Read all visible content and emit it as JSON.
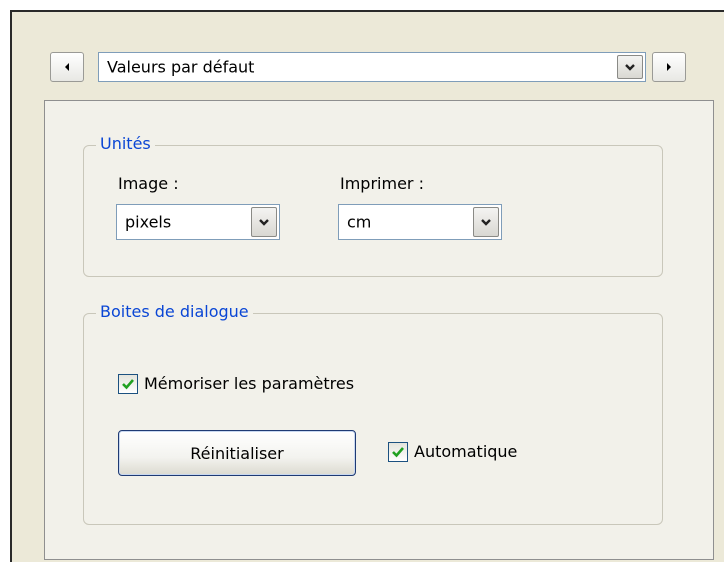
{
  "header": {
    "preset_value": "Valeurs par défaut",
    "prev_icon": "chevron-left-icon",
    "next_icon": "chevron-right-icon"
  },
  "units": {
    "legend": "Unités",
    "image_label": "Image :",
    "image_value": "pixels",
    "print_label": "Imprimer :",
    "print_value": "cm"
  },
  "dialogs": {
    "legend": "Boites de dialogue",
    "remember_label": "Mémoriser les paramètres",
    "remember_checked": true,
    "reset_button": "Réinitialiser",
    "auto_label": "Automatique",
    "auto_checked": true
  },
  "colors": {
    "group_title": "#0a46d5",
    "dialog_bg": "#ece9d8",
    "check_mark": "#21a121"
  }
}
